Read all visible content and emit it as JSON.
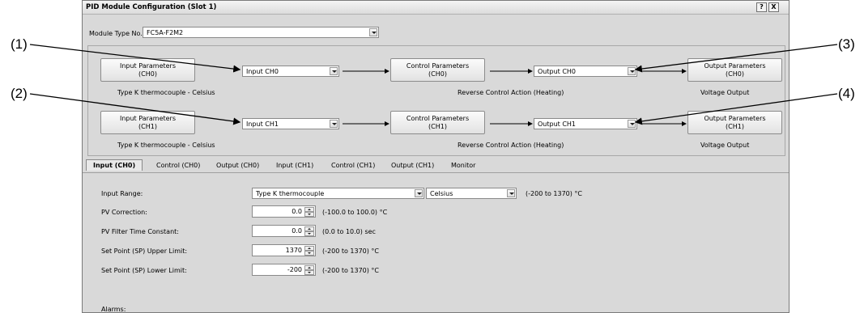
{
  "callouts": [
    "(1)",
    "(2)",
    "(3)",
    "(4)"
  ],
  "window": {
    "title": "PID Module Configuration (Slot 1)",
    "help_label": "?",
    "close_label": "X"
  },
  "module_type": {
    "label": "Module Type No.:",
    "value": "FC5A-F2M2"
  },
  "flow": {
    "rows": [
      {
        "input_params": [
          "Input Parameters",
          "(CH0)"
        ],
        "input_caption": "Type K thermocouple - Celsius",
        "input_select": "Input CH0",
        "control_params": [
          "Control Parameters",
          "(CH0)"
        ],
        "control_caption": "Reverse Control Action (Heating)",
        "output_select": "Output CH0",
        "output_params": [
          "Output Parameters",
          "(CH0)"
        ],
        "output_caption": "Voltage Output"
      },
      {
        "input_params": [
          "Input Parameters",
          "(CH1)"
        ],
        "input_caption": "Type K thermocouple - Celsius",
        "input_select": "Input CH1",
        "control_params": [
          "Control Parameters",
          "(CH1)"
        ],
        "control_caption": "Reverse Control Action (Heating)",
        "output_select": "Output CH1",
        "output_params": [
          "Output Parameters",
          "(CH1)"
        ],
        "output_caption": "Voltage Output"
      }
    ]
  },
  "tabs": [
    "Input (CH0)",
    "Control (CH0)",
    "Output (CH0)",
    "Input (CH1)",
    "Control (CH1)",
    "Output (CH1)",
    "Monitor"
  ],
  "active_tab": "Input (CH0)",
  "form": {
    "input_range": {
      "label": "Input Range:",
      "type_value": "Type K thermocouple",
      "unit_value": "Celsius",
      "range": "(-200 to 1370) °C"
    },
    "pv_correction": {
      "label": "PV Correction:",
      "value": "0.0",
      "range": "(-100.0 to 100.0) °C"
    },
    "pv_filter": {
      "label": "PV Filter Time Constant:",
      "value": "0.0",
      "range": "(0.0 to 10.0) sec"
    },
    "sp_upper": {
      "label": "Set Point (SP) Upper Limit:",
      "value": "1370",
      "range": "(-200 to 1370) °C"
    },
    "sp_lower": {
      "label": "Set Point (SP) Lower Limit:",
      "value": "-200",
      "range": "(-200 to 1370) °C"
    },
    "alarms": {
      "label": "Alarms:"
    }
  }
}
